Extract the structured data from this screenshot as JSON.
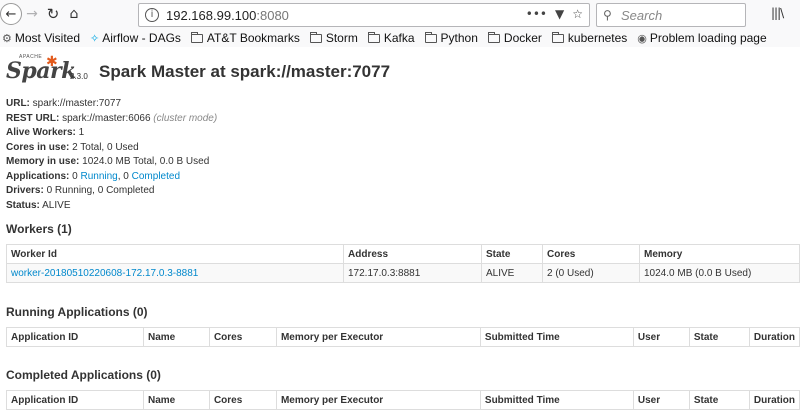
{
  "browser": {
    "url_host": "192.168.99.100",
    "url_port": ":8080",
    "url_dots": "•••",
    "search_placeholder": "Search",
    "icons": {
      "back": "back-arrow-icon",
      "forward": "forward-arrow-icon",
      "reload": "reload-icon",
      "home": "home-icon",
      "info": "info-icon",
      "pocket": "pocket-icon",
      "bookmark": "star-icon",
      "search": "search-icon",
      "library": "library-icon"
    }
  },
  "bookmarks": [
    {
      "label": "Most Visited",
      "icon": "gear-icon"
    },
    {
      "label": "Airflow - DAGs",
      "icon": "airflow-icon"
    },
    {
      "label": "AT&T Bookmarks",
      "icon": "folder-icon"
    },
    {
      "label": "Storm",
      "icon": "folder-icon"
    },
    {
      "label": "Kafka",
      "icon": "folder-icon"
    },
    {
      "label": "Python",
      "icon": "folder-icon"
    },
    {
      "label": "Docker",
      "icon": "folder-icon"
    },
    {
      "label": "kubernetes",
      "icon": "folder-icon"
    },
    {
      "label": "Problem loading page",
      "icon": "globe-icon"
    }
  ],
  "logo": {
    "apache": "APACHE",
    "word": "Spark",
    "version": "2.3.0"
  },
  "page_title": "Spark Master at spark://master:7077",
  "info": {
    "url_label": "URL:",
    "url_value": "spark://master:7077",
    "rest_label": "REST URL:",
    "rest_value": "spark://master:6066",
    "rest_mode": "(cluster mode)",
    "workers_label": "Alive Workers:",
    "workers_value": "1",
    "cores_label": "Cores in use:",
    "cores_value": "2 Total, 0 Used",
    "memory_label": "Memory in use:",
    "memory_value": "1024.0 MB Total, 0.0 B Used",
    "apps_label": "Applications:",
    "apps_running_count": "0",
    "apps_running_link": "Running",
    "apps_completed_count": "0",
    "apps_completed_link": "Completed",
    "drivers_label": "Drivers:",
    "drivers_value": "0 Running, 0 Completed",
    "status_label": "Status:",
    "status_value": "ALIVE"
  },
  "workers": {
    "title": "Workers (1)",
    "headers": [
      "Worker Id",
      "Address",
      "State",
      "Cores",
      "Memory"
    ],
    "rows": [
      [
        "worker-20180510220608-172.17.0.3-8881",
        "172.17.0.3:8881",
        "ALIVE",
        "2 (0 Used)",
        "1024.0 MB (0.0 B Used)"
      ]
    ]
  },
  "running_apps": {
    "title": "Running Applications (0)",
    "headers": [
      "Application ID",
      "Name",
      "Cores",
      "Memory per Executor",
      "Submitted Time",
      "User",
      "State",
      "Duration"
    ]
  },
  "completed_apps": {
    "title": "Completed Applications (0)",
    "headers": [
      "Application ID",
      "Name",
      "Cores",
      "Memory per Executor",
      "Submitted Time",
      "User",
      "State",
      "Duration"
    ]
  },
  "colors": {
    "link": "#0088cc",
    "spark_orange": "#e25a1c",
    "chrome_bg": "#f9f9fa"
  }
}
